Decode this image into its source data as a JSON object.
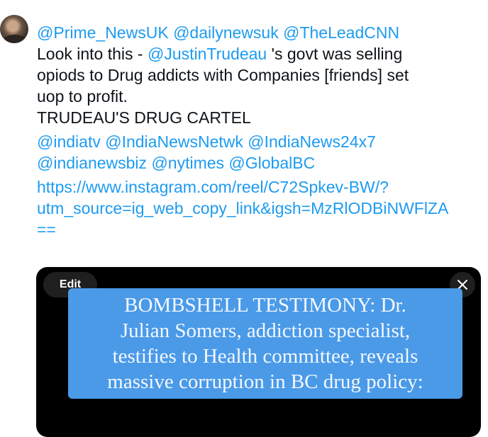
{
  "tweet": {
    "line1": [
      "@Prime_NewsUK",
      "@dailynewsuk",
      "@TheLeadCNN"
    ],
    "body_prefix": "Look into this - ",
    "body_mention": "@JustinTrudeau",
    "body_rest_1": " 's govt was selling",
    "body_line3": "opiods to Drug addicts with Companies [friends] set",
    "body_line4": "uop to profit.",
    "headline": "TRUDEAU'S DRUG CARTEL",
    "mentions_line1": [
      "@indiatv",
      "@IndiaNewsNetwk",
      "@IndiaNews24x7"
    ],
    "mentions_line2": [
      "@indianewsbiz",
      "@nytimes",
      "@GlobalBC"
    ],
    "link_line1": "https://www.instagram.com/reel/C72Spkev-BW/?",
    "link_line2": "utm_source=ig_web_copy_link&igsh=MzRlODBiNWFlZA",
    "link_line3": "=="
  },
  "media": {
    "edit_label": "Edit",
    "close_icon": "close-icon",
    "caption_lines": [
      "BOMBSHELL TESTIMONY: Dr.",
      "Julian Somers, addiction specialist,",
      "testifies to Health committee, reveals",
      "massive corruption in BC drug policy:"
    ]
  },
  "colors": {
    "link": "#1d9bf0",
    "caption_bg": "#4a9ae8"
  }
}
